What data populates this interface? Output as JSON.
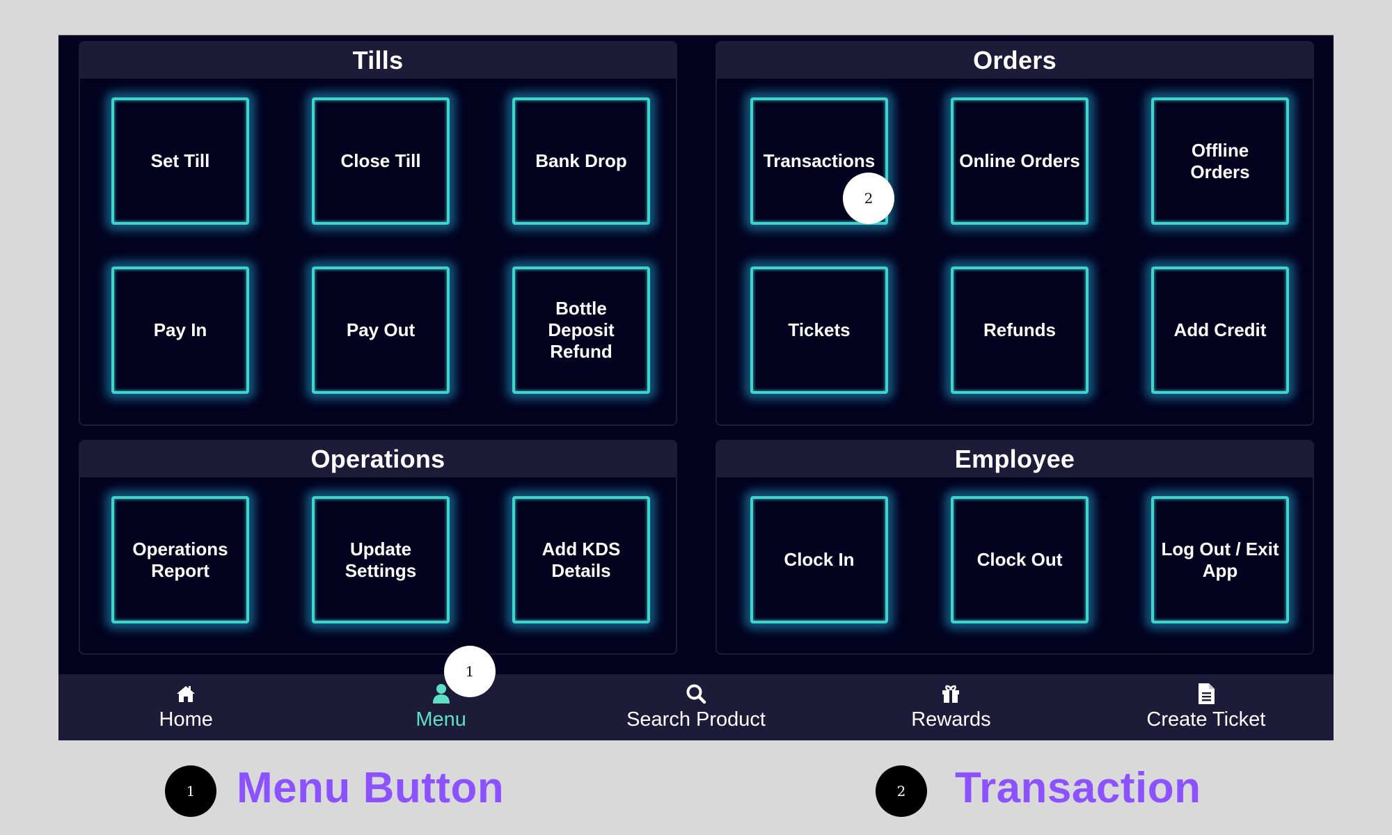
{
  "panels": [
    {
      "title": "Tills",
      "buttons": [
        "Set Till",
        "Close Till",
        "Bank Drop",
        "Pay In",
        "Pay Out",
        "Bottle Deposit Refund"
      ]
    },
    {
      "title": "Orders",
      "buttons": [
        "Transactions",
        "Online Orders",
        "Offline Orders",
        "Tickets",
        "Refunds",
        "Add Credit"
      ]
    },
    {
      "title": "Operations",
      "buttons": [
        "Operations Report",
        "Update Settings",
        "Add KDS Details"
      ]
    },
    {
      "title": "Employee",
      "buttons": [
        "Clock In",
        "Clock Out",
        "Log Out / Exit App"
      ]
    }
  ],
  "navbar": {
    "items": [
      {
        "label": "Home",
        "icon": "home-icon",
        "active": false
      },
      {
        "label": "Menu",
        "icon": "user-icon",
        "active": true
      },
      {
        "label": "Search Product",
        "icon": "search-icon",
        "active": false
      },
      {
        "label": "Rewards",
        "icon": "gift-icon",
        "active": false
      },
      {
        "label": "Create Ticket",
        "icon": "document-icon",
        "active": false
      }
    ],
    "active_color": "#5ce1c6"
  },
  "markers": [
    {
      "number": "1",
      "target": "Menu"
    },
    {
      "number": "2",
      "target": "Transactions"
    }
  ],
  "legend": [
    {
      "number": "1",
      "label": "Menu Button"
    },
    {
      "number": "2",
      "label": "Transaction"
    }
  ],
  "colors": {
    "background": "#d9d9d9",
    "screen": "#02021f",
    "panel_header": "#1c1c38",
    "tile_border": "#3ed4cb",
    "legend_text": "#8c52ff"
  }
}
